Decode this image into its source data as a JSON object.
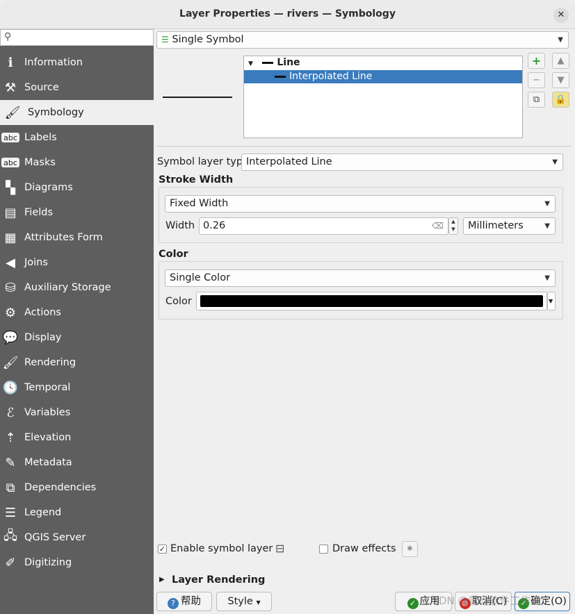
{
  "window": {
    "title": "Layer Properties — rivers — Symbology",
    "close_glyph": "✕"
  },
  "sidebar": {
    "search": {
      "placeholder": "",
      "icon": "search-icon"
    },
    "items": [
      {
        "label": "Information",
        "icon": "info-icon",
        "glyph": "ℹ"
      },
      {
        "label": "Source",
        "icon": "wrench-icon",
        "glyph": "⚒"
      },
      {
        "label": "Symbology",
        "icon": "paintbrush-icon",
        "glyph": "🖌",
        "active": true
      },
      {
        "label": "Labels",
        "icon": "labels-icon",
        "glyph": "abc"
      },
      {
        "label": "Masks",
        "icon": "masks-icon",
        "glyph": "abc"
      },
      {
        "label": "Diagrams",
        "icon": "diagrams-icon",
        "glyph": "▚"
      },
      {
        "label": "Fields",
        "icon": "fields-icon",
        "glyph": "▤"
      },
      {
        "label": "Attributes Form",
        "icon": "form-icon",
        "glyph": "▦"
      },
      {
        "label": "Joins",
        "icon": "joins-icon",
        "glyph": "◀"
      },
      {
        "label": "Auxiliary Storage",
        "icon": "database-icon",
        "glyph": "⛁"
      },
      {
        "label": "Actions",
        "icon": "gear-icon",
        "glyph": "⚙"
      },
      {
        "label": "Display",
        "icon": "speech-bubble-icon",
        "glyph": "💬"
      },
      {
        "label": "Rendering",
        "icon": "brush-icon",
        "glyph": "🖌"
      },
      {
        "label": "Temporal",
        "icon": "clock-icon",
        "glyph": "🕓"
      },
      {
        "label": "Variables",
        "icon": "variables-icon",
        "glyph": "ℰ"
      },
      {
        "label": "Elevation",
        "icon": "elevation-icon",
        "glyph": "⇡"
      },
      {
        "label": "Metadata",
        "icon": "metadata-icon",
        "glyph": "✎"
      },
      {
        "label": "Dependencies",
        "icon": "dependencies-icon",
        "glyph": "⧉"
      },
      {
        "label": "Legend",
        "icon": "legend-icon",
        "glyph": "☰"
      },
      {
        "label": "QGIS Server",
        "icon": "server-icon",
        "glyph": "🖧"
      },
      {
        "label": "Digitizing",
        "icon": "digitizing-icon",
        "glyph": "✐"
      }
    ]
  },
  "renderer": {
    "selected": "Single Symbol",
    "icon": "single-symbol-icon"
  },
  "symbol_tree": {
    "root": "Line",
    "child": "Interpolated Line"
  },
  "symbol_buttons": {
    "add": "+",
    "remove": "−",
    "up": "▲",
    "down": "▼",
    "duplicate": "⧉",
    "lock": "🔒"
  },
  "layer_type": {
    "label": "Symbol layer type",
    "selected": "Interpolated Line"
  },
  "stroke_width": {
    "heading": "Stroke Width",
    "mode": "Fixed Width",
    "width_label": "Width",
    "width_value": "0.26",
    "unit": "Millimeters"
  },
  "color": {
    "heading": "Color",
    "mode": "Single Color",
    "color_label": "Color",
    "value": "#000000"
  },
  "options": {
    "enable_layer_label": "Enable symbol layer",
    "enable_layer_checked": true,
    "draw_effects_label": "Draw effects",
    "draw_effects_checked": false
  },
  "layer_rendering": {
    "label": "Layer Rendering"
  },
  "buttons": {
    "help": "帮助",
    "style": "Style",
    "apply": "应用",
    "cancel": "取消(C)",
    "ok": "确定(O)"
  },
  "watermark": "CSDN @雷动软件工作室"
}
